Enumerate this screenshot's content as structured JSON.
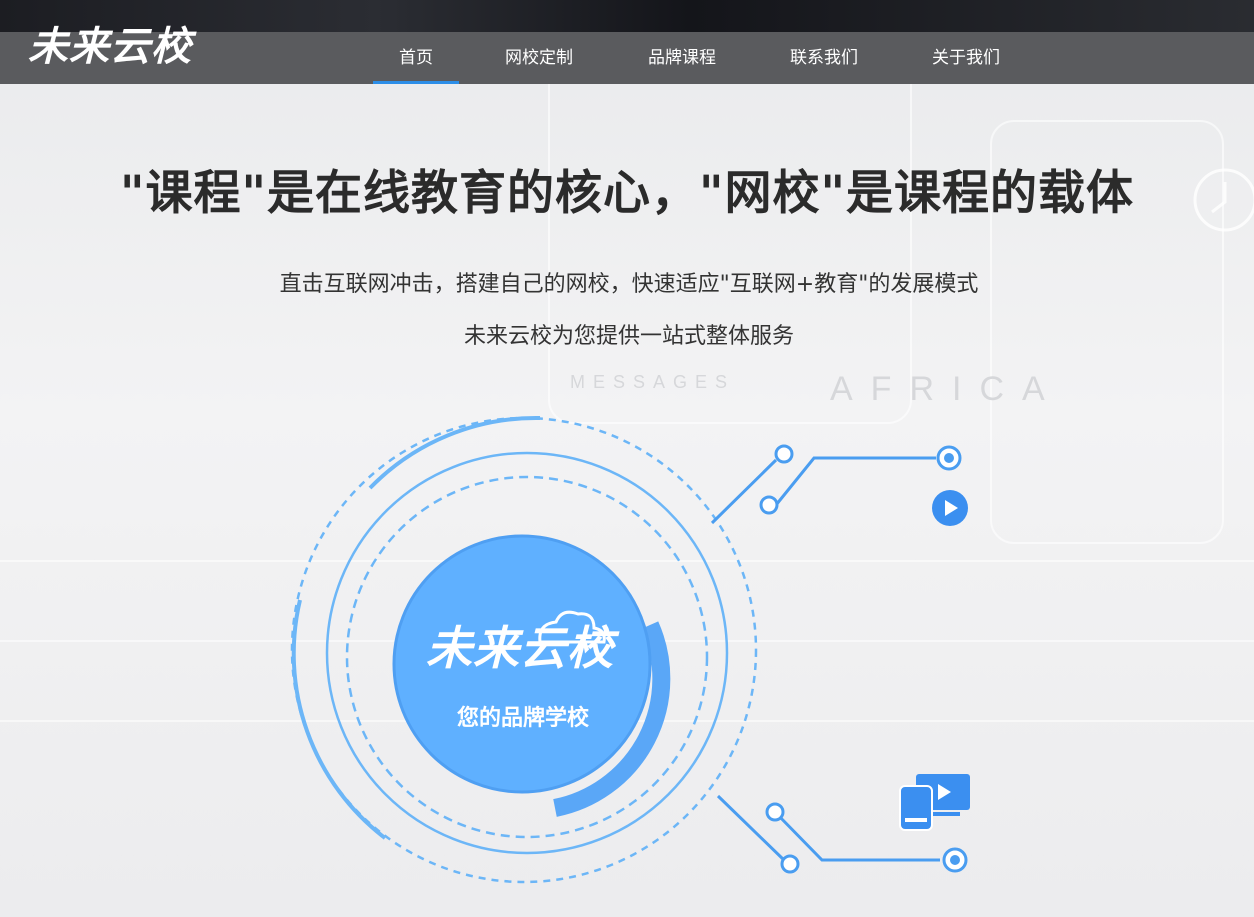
{
  "brand": {
    "logo_text": "未来云校",
    "center_logo_text": "未来云校",
    "center_tagline": "您的品牌学校"
  },
  "nav": {
    "items": [
      {
        "label": "首页",
        "active": true
      },
      {
        "label": "网校定制",
        "active": false
      },
      {
        "label": "品牌课程",
        "active": false
      },
      {
        "label": "联系我们",
        "active": false
      },
      {
        "label": "关于我们",
        "active": false
      }
    ]
  },
  "hero": {
    "title": "\"课程\"是在线教育的核心，\"网校\"是课程的载体",
    "line1": "直击互联网冲击，搭建自己的网校，快速适应\"互联网+教育\"的发展模式",
    "line2": "未来云校为您提供一站式整体服务"
  },
  "colors": {
    "accent": "#2c8ee8",
    "circle_fill": "#5fb0ff",
    "ring": "#6cb6f7",
    "navbar": "#5a5b5e",
    "title_text": "#2b2b2b"
  },
  "icons": [
    "play-icon",
    "devices-icon",
    "cloud-icon"
  ]
}
